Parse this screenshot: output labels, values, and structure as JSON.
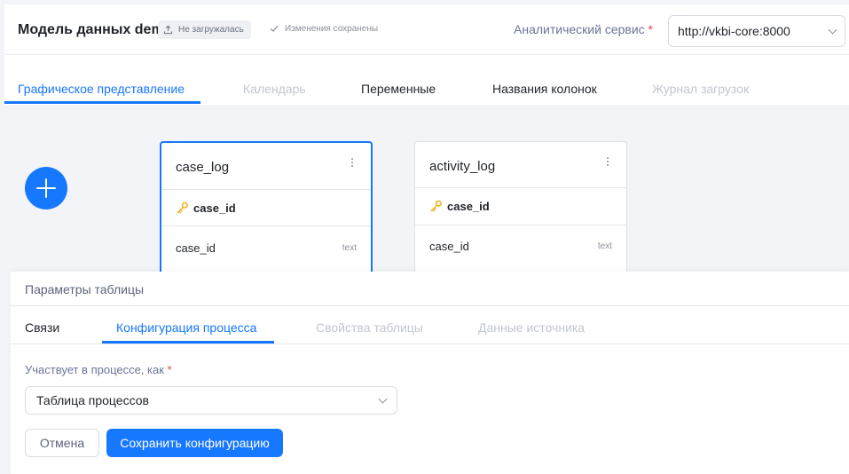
{
  "header": {
    "model_title": "Модель данных demo",
    "upload_badge": "Не загружалась",
    "saved_status": "Изменения сохранены",
    "service_label": "Аналитический сервис",
    "required_mark": "*",
    "service_value": "http://vkbi-core:8000"
  },
  "tabs": [
    {
      "label": "Графическое представление",
      "state": "active"
    },
    {
      "label": "Календарь",
      "state": "disabled"
    },
    {
      "label": "Переменные",
      "state": "normal"
    },
    {
      "label": "Названия колонок",
      "state": "normal"
    },
    {
      "label": "Журнал загрузок",
      "state": "disabled"
    }
  ],
  "cards": [
    {
      "title": "case_log",
      "key_column": "case_id",
      "columns": [
        {
          "name": "case_id",
          "type": "text"
        }
      ],
      "selected": true
    },
    {
      "title": "activity_log",
      "key_column": "case_id",
      "columns": [
        {
          "name": "case_id",
          "type": "text"
        }
      ],
      "selected": false
    }
  ],
  "panel": {
    "title": "Параметры таблицы",
    "tabs": [
      {
        "label": "Связи",
        "state": "normal"
      },
      {
        "label": "Конфигурация процесса",
        "state": "active"
      },
      {
        "label": "Свойства таблицы",
        "state": "disabled"
      },
      {
        "label": "Данные источника",
        "state": "disabled"
      }
    ],
    "field_label": "Участвует в процессе, как",
    "required_mark": "*",
    "field_value": "Таблица процессов",
    "cancel_label": "Отмена",
    "save_label": "Сохранить конфигурацию"
  },
  "colors": {
    "accent": "#1677ff",
    "key_icon": "#f2b01e",
    "required": "#e5484d"
  },
  "icons": {
    "upload": "upload-icon",
    "check": "check-icon",
    "chevron": "chevron-down-icon",
    "add": "plus-icon",
    "key": "key-icon",
    "more": "more-vertical-icon"
  }
}
